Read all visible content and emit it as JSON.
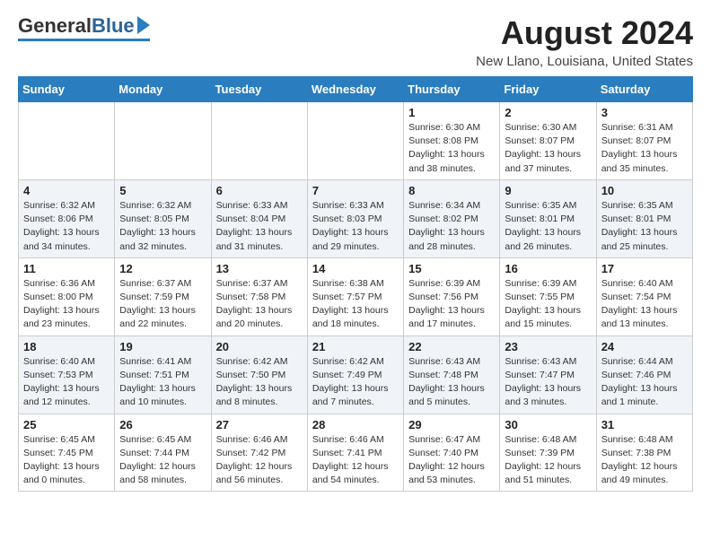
{
  "header": {
    "logo_general": "General",
    "logo_blue": "Blue",
    "month_title": "August 2024",
    "location": "New Llano, Louisiana, United States"
  },
  "days_of_week": [
    "Sunday",
    "Monday",
    "Tuesday",
    "Wednesday",
    "Thursday",
    "Friday",
    "Saturday"
  ],
  "weeks": [
    [
      {
        "day": "",
        "info": ""
      },
      {
        "day": "",
        "info": ""
      },
      {
        "day": "",
        "info": ""
      },
      {
        "day": "",
        "info": ""
      },
      {
        "day": "1",
        "info": "Sunrise: 6:30 AM\nSunset: 8:08 PM\nDaylight: 13 hours\nand 38 minutes."
      },
      {
        "day": "2",
        "info": "Sunrise: 6:30 AM\nSunset: 8:07 PM\nDaylight: 13 hours\nand 37 minutes."
      },
      {
        "day": "3",
        "info": "Sunrise: 6:31 AM\nSunset: 8:07 PM\nDaylight: 13 hours\nand 35 minutes."
      }
    ],
    [
      {
        "day": "4",
        "info": "Sunrise: 6:32 AM\nSunset: 8:06 PM\nDaylight: 13 hours\nand 34 minutes."
      },
      {
        "day": "5",
        "info": "Sunrise: 6:32 AM\nSunset: 8:05 PM\nDaylight: 13 hours\nand 32 minutes."
      },
      {
        "day": "6",
        "info": "Sunrise: 6:33 AM\nSunset: 8:04 PM\nDaylight: 13 hours\nand 31 minutes."
      },
      {
        "day": "7",
        "info": "Sunrise: 6:33 AM\nSunset: 8:03 PM\nDaylight: 13 hours\nand 29 minutes."
      },
      {
        "day": "8",
        "info": "Sunrise: 6:34 AM\nSunset: 8:02 PM\nDaylight: 13 hours\nand 28 minutes."
      },
      {
        "day": "9",
        "info": "Sunrise: 6:35 AM\nSunset: 8:01 PM\nDaylight: 13 hours\nand 26 minutes."
      },
      {
        "day": "10",
        "info": "Sunrise: 6:35 AM\nSunset: 8:01 PM\nDaylight: 13 hours\nand 25 minutes."
      }
    ],
    [
      {
        "day": "11",
        "info": "Sunrise: 6:36 AM\nSunset: 8:00 PM\nDaylight: 13 hours\nand 23 minutes."
      },
      {
        "day": "12",
        "info": "Sunrise: 6:37 AM\nSunset: 7:59 PM\nDaylight: 13 hours\nand 22 minutes."
      },
      {
        "day": "13",
        "info": "Sunrise: 6:37 AM\nSunset: 7:58 PM\nDaylight: 13 hours\nand 20 minutes."
      },
      {
        "day": "14",
        "info": "Sunrise: 6:38 AM\nSunset: 7:57 PM\nDaylight: 13 hours\nand 18 minutes."
      },
      {
        "day": "15",
        "info": "Sunrise: 6:39 AM\nSunset: 7:56 PM\nDaylight: 13 hours\nand 17 minutes."
      },
      {
        "day": "16",
        "info": "Sunrise: 6:39 AM\nSunset: 7:55 PM\nDaylight: 13 hours\nand 15 minutes."
      },
      {
        "day": "17",
        "info": "Sunrise: 6:40 AM\nSunset: 7:54 PM\nDaylight: 13 hours\nand 13 minutes."
      }
    ],
    [
      {
        "day": "18",
        "info": "Sunrise: 6:40 AM\nSunset: 7:53 PM\nDaylight: 13 hours\nand 12 minutes."
      },
      {
        "day": "19",
        "info": "Sunrise: 6:41 AM\nSunset: 7:51 PM\nDaylight: 13 hours\nand 10 minutes."
      },
      {
        "day": "20",
        "info": "Sunrise: 6:42 AM\nSunset: 7:50 PM\nDaylight: 13 hours\nand 8 minutes."
      },
      {
        "day": "21",
        "info": "Sunrise: 6:42 AM\nSunset: 7:49 PM\nDaylight: 13 hours\nand 7 minutes."
      },
      {
        "day": "22",
        "info": "Sunrise: 6:43 AM\nSunset: 7:48 PM\nDaylight: 13 hours\nand 5 minutes."
      },
      {
        "day": "23",
        "info": "Sunrise: 6:43 AM\nSunset: 7:47 PM\nDaylight: 13 hours\nand 3 minutes."
      },
      {
        "day": "24",
        "info": "Sunrise: 6:44 AM\nSunset: 7:46 PM\nDaylight: 13 hours\nand 1 minute."
      }
    ],
    [
      {
        "day": "25",
        "info": "Sunrise: 6:45 AM\nSunset: 7:45 PM\nDaylight: 13 hours\nand 0 minutes."
      },
      {
        "day": "26",
        "info": "Sunrise: 6:45 AM\nSunset: 7:44 PM\nDaylight: 12 hours\nand 58 minutes."
      },
      {
        "day": "27",
        "info": "Sunrise: 6:46 AM\nSunset: 7:42 PM\nDaylight: 12 hours\nand 56 minutes."
      },
      {
        "day": "28",
        "info": "Sunrise: 6:46 AM\nSunset: 7:41 PM\nDaylight: 12 hours\nand 54 minutes."
      },
      {
        "day": "29",
        "info": "Sunrise: 6:47 AM\nSunset: 7:40 PM\nDaylight: 12 hours\nand 53 minutes."
      },
      {
        "day": "30",
        "info": "Sunrise: 6:48 AM\nSunset: 7:39 PM\nDaylight: 12 hours\nand 51 minutes."
      },
      {
        "day": "31",
        "info": "Sunrise: 6:48 AM\nSunset: 7:38 PM\nDaylight: 12 hours\nand 49 minutes."
      }
    ]
  ]
}
